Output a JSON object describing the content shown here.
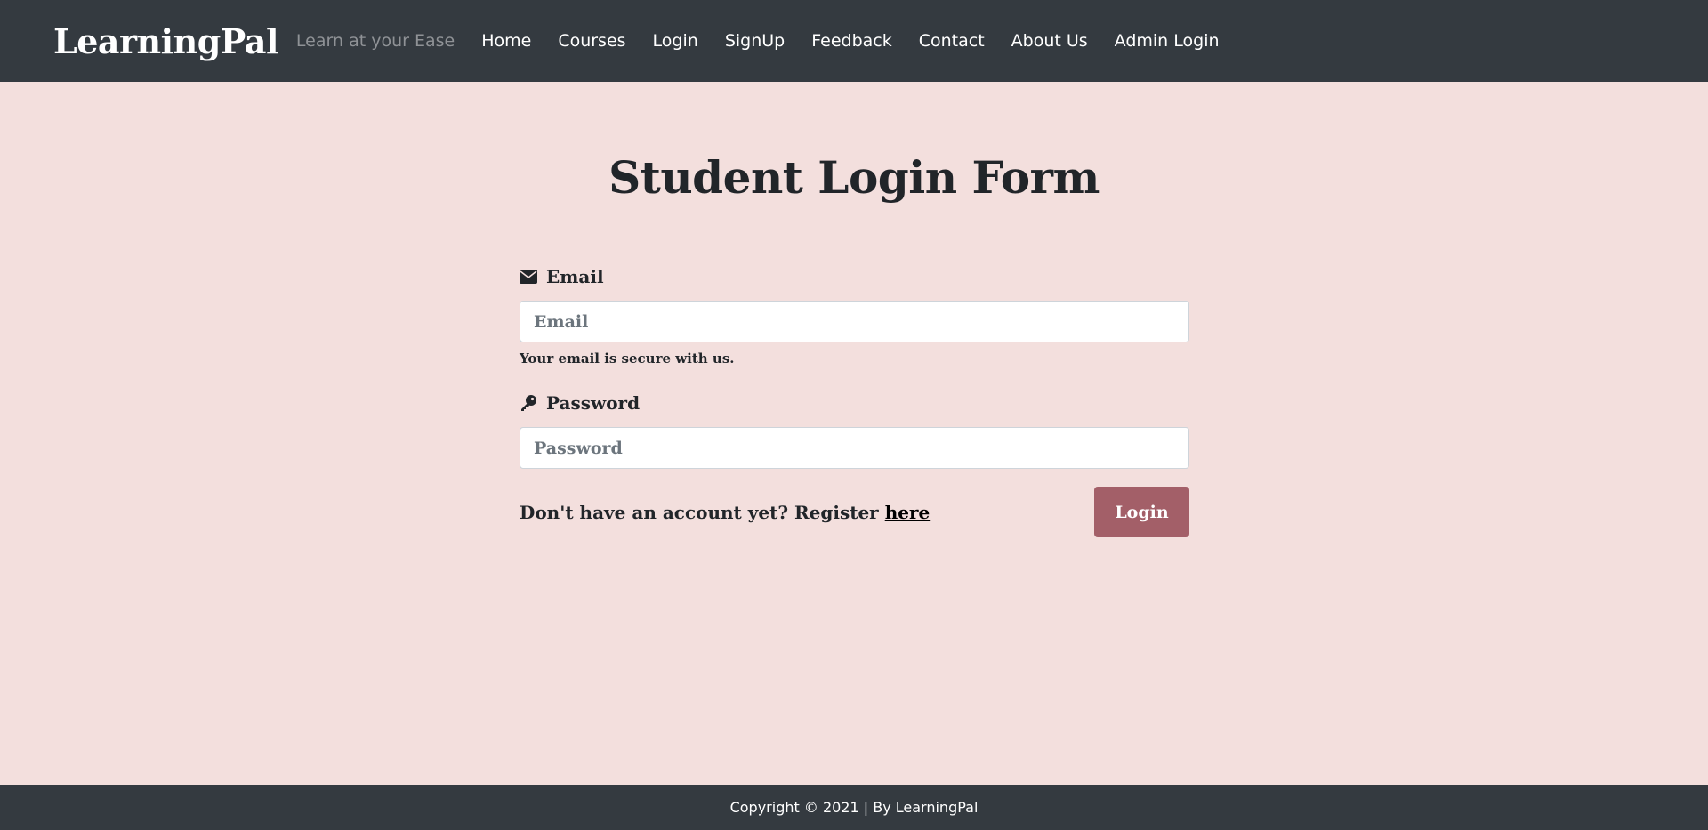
{
  "navbar": {
    "brand": "LearningPal",
    "tagline": "Learn at your Ease",
    "links": [
      "Home",
      "Courses",
      "Login",
      "SignUp",
      "Feedback",
      "Contact",
      "About Us",
      "Admin Login"
    ]
  },
  "main": {
    "title": "Student Login Form",
    "email": {
      "icon": "envelope-icon",
      "label": "Email",
      "placeholder": "Email",
      "value": "",
      "help": "Your email is secure with us."
    },
    "password": {
      "icon": "key-icon",
      "label": "Password",
      "placeholder": "Password",
      "value": ""
    },
    "register": {
      "text": "Don't have an account yet? Register ",
      "link": "here"
    },
    "login_button": "Login"
  },
  "footer": {
    "text": "Copyright © 2021 | By LearningPal"
  },
  "colors": {
    "navbar_bg": "#343a40",
    "page_bg": "#f3dfdd",
    "button_bg": "#a35f68",
    "tagline": "#8f9296"
  }
}
